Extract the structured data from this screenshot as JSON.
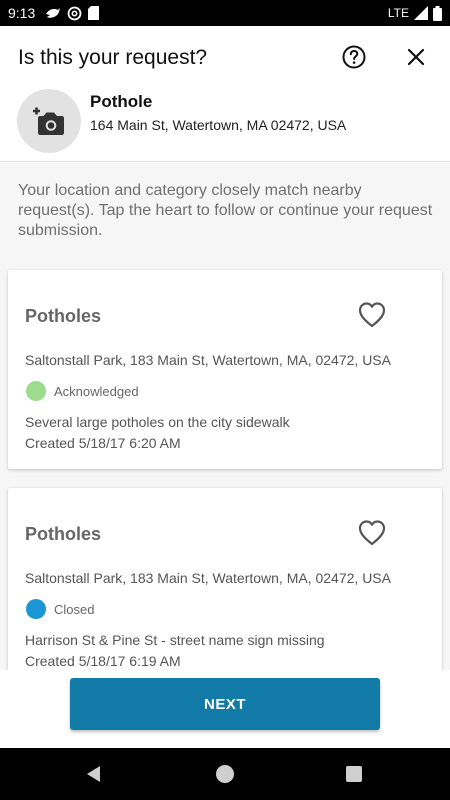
{
  "status_bar": {
    "time": "9:13",
    "network": "LTE",
    "icons": [
      "bird-icon",
      "at-sign-icon",
      "sd-card-icon",
      "signal-icon",
      "battery-icon"
    ]
  },
  "header": {
    "title": "Is this your request?",
    "help_icon": "help-circle-icon",
    "close_icon": "close-icon",
    "camera_icon": "add-photo-icon",
    "category": "Pothole",
    "address": "164 Main St, Watertown, MA 02472, USA"
  },
  "intro_text": "Your location and category closely match nearby request(s). Tap the heart to follow or continue your request submission.",
  "requests": [
    {
      "title": "Potholes",
      "address": "Saltonstall Park, 183 Main St, Watertown, MA, 02472, USA",
      "status": "Acknowledged",
      "status_color": "#9ddc8e",
      "description": "Several large potholes on the city sidewalk",
      "created": "Created 5/18/17 6:20 AM"
    },
    {
      "title": "Potholes",
      "address": "Saltonstall Park, 183 Main St, Watertown, MA, 02472, USA",
      "status": "Closed",
      "status_color": "#1a96d4",
      "description": "Harrison St & Pine St - street name sign missing",
      "created": "Created 5/18/17 6:19 AM"
    }
  ],
  "footer": {
    "next_label": "NEXT"
  },
  "colors": {
    "accent": "#127aa6",
    "background": "#f6f6f6"
  }
}
